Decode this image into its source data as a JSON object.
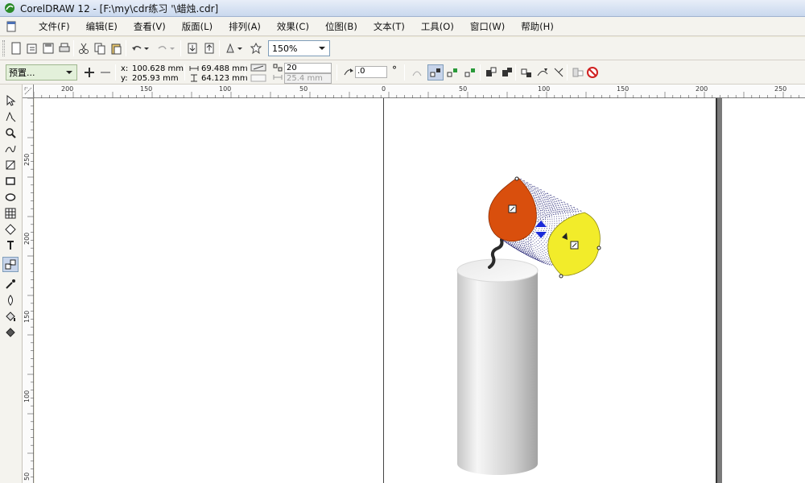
{
  "window": {
    "title": "CorelDRAW 12 - [F:\\my\\cdr练习  '\\蜡烛.cdr]"
  },
  "menu": {
    "items": [
      "文件(F)",
      "编辑(E)",
      "查看(V)",
      "版面(L)",
      "排列(A)",
      "效果(C)",
      "位图(B)",
      "文本(T)",
      "工具(O)",
      "窗口(W)",
      "帮助(H)"
    ]
  },
  "standard_toolbar": {
    "zoom_level": "150%"
  },
  "property_bar": {
    "preset_value": "预置...",
    "x_label": "x:",
    "x_value": "100.628 mm",
    "y_label": "y:",
    "y_value": "205.93 mm",
    "width_value": "69.488 mm",
    "height_value": "64.123 mm",
    "steps_value": "20",
    "spacing_value": "25.4 mm",
    "rotation_value": ".0",
    "degree_symbol": "°"
  },
  "rulers": {
    "horizontal_labels": [
      "200",
      "150",
      "100",
      "50",
      "0",
      "50",
      "100",
      "150",
      "200",
      "250"
    ],
    "vertical_labels": [
      "250",
      "200",
      "150",
      "100",
      "50"
    ]
  },
  "colors": {
    "flame_red": "#d94f0d",
    "flame_yellow": "#f2ec2a",
    "candle_light": "#f4f4f4",
    "candle_dark": "#a9a9a9",
    "blend_dots": "#1a1a6e",
    "ui_bg": "#f4f3ee"
  },
  "icons": {
    "toolbox": [
      "pick-tool-icon",
      "shape-tool-icon",
      "zoom-tool-icon",
      "freehand-tool-icon",
      "smart-fill-tool-icon",
      "rectangle-tool-icon",
      "ellipse-tool-icon",
      "graph-paper-tool-icon",
      "basic-shapes-tool-icon",
      "text-tool-icon",
      "interactive-blend-tool-icon",
      "eyedropper-tool-icon",
      "outline-tool-icon",
      "fill-tool-icon",
      "interactive-fill-tool-icon"
    ]
  }
}
